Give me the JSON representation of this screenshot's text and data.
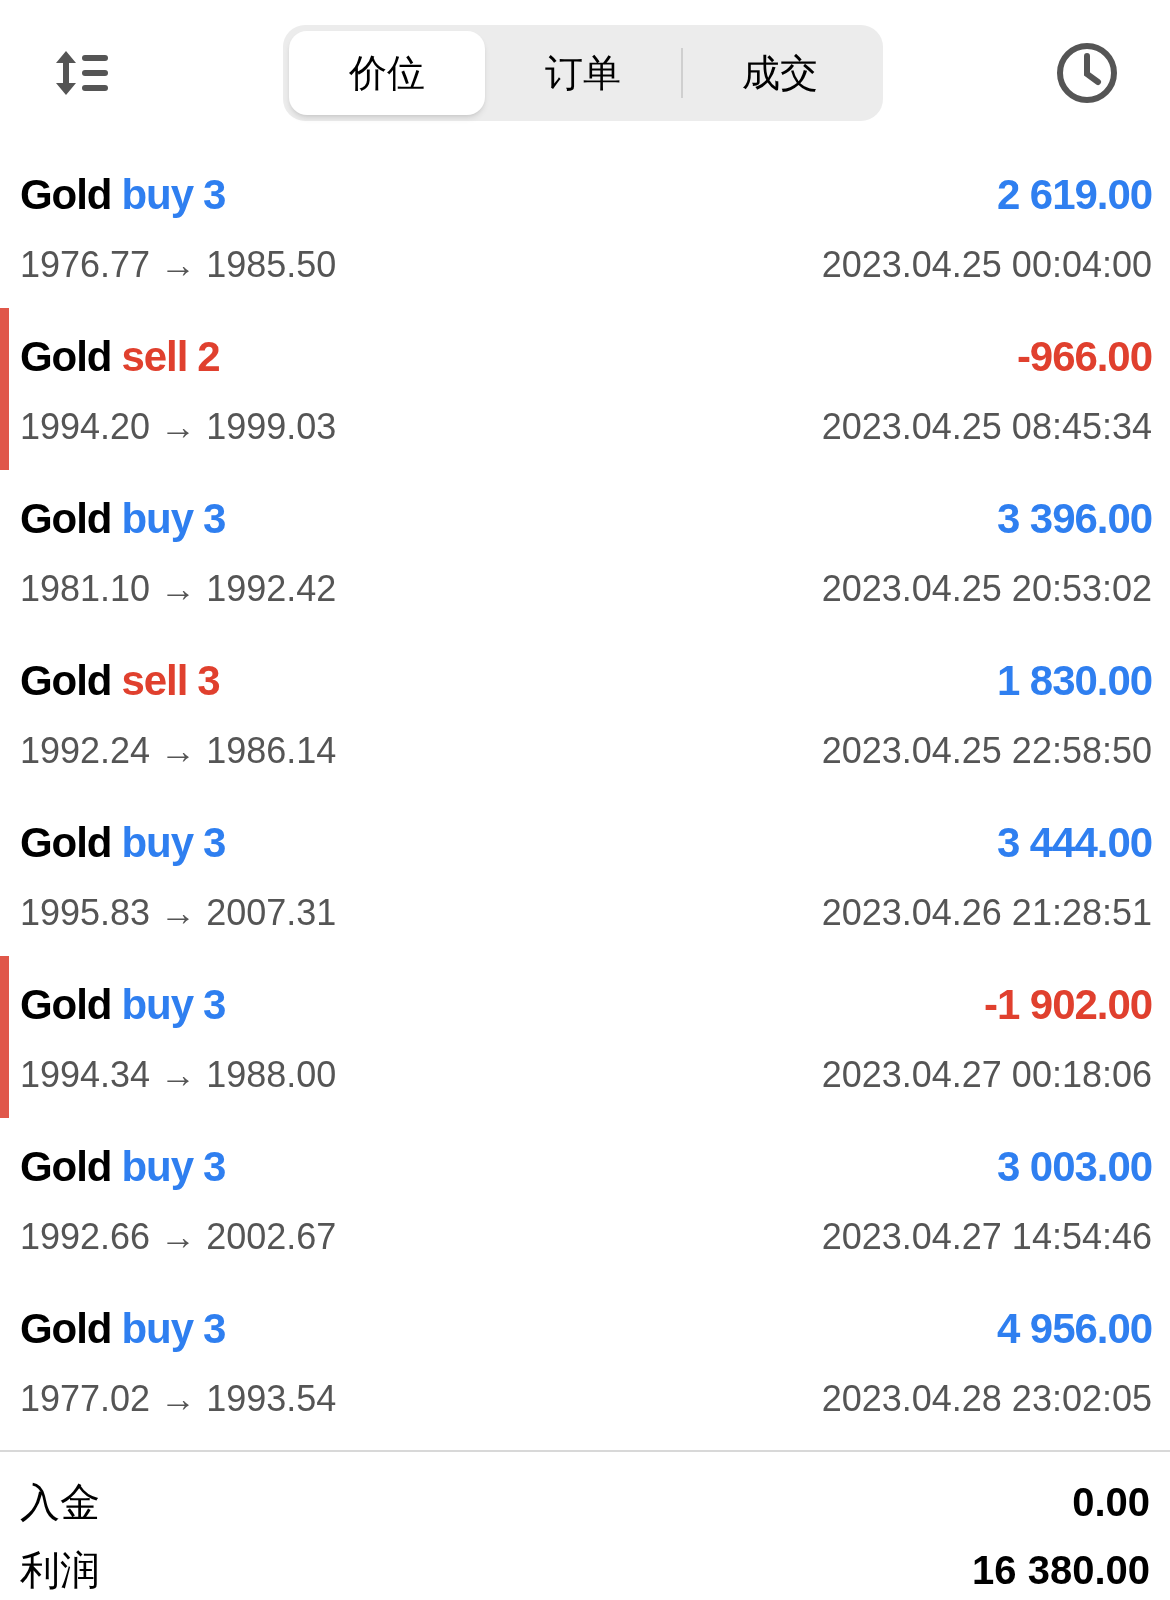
{
  "tabs": [
    {
      "label": "价位",
      "selected": true
    },
    {
      "label": "订单",
      "selected": false
    },
    {
      "label": "成交",
      "selected": false
    }
  ],
  "deals": [
    {
      "symbol": "Gold",
      "side": "buy",
      "volume": "3",
      "prices": "1976.77 → 1985.50",
      "profit": "2 619.00",
      "loss": false,
      "time": "2023.04.25 00:04:00"
    },
    {
      "symbol": "Gold",
      "side": "sell",
      "volume": "2",
      "prices": "1994.20 → 1999.03",
      "profit": "-966.00",
      "loss": true,
      "time": "2023.04.25 08:45:34"
    },
    {
      "symbol": "Gold",
      "side": "buy",
      "volume": "3",
      "prices": "1981.10 → 1992.42",
      "profit": "3 396.00",
      "loss": false,
      "time": "2023.04.25 20:53:02"
    },
    {
      "symbol": "Gold",
      "side": "sell",
      "volume": "3",
      "prices": "1992.24 → 1986.14",
      "profit": "1 830.00",
      "loss": false,
      "time": "2023.04.25 22:58:50"
    },
    {
      "symbol": "Gold",
      "side": "buy",
      "volume": "3",
      "prices": "1995.83 → 2007.31",
      "profit": "3 444.00",
      "loss": false,
      "time": "2023.04.26 21:28:51"
    },
    {
      "symbol": "Gold",
      "side": "buy",
      "volume": "3",
      "prices": "1994.34 → 1988.00",
      "profit": "-1 902.00",
      "loss": true,
      "time": "2023.04.27 00:18:06"
    },
    {
      "symbol": "Gold",
      "side": "buy",
      "volume": "3",
      "prices": "1992.66 → 2002.67",
      "profit": "3 003.00",
      "loss": false,
      "time": "2023.04.27 14:54:46"
    },
    {
      "symbol": "Gold",
      "side": "buy",
      "volume": "3",
      "prices": "1977.02 → 1993.54",
      "profit": "4 956.00",
      "loss": false,
      "time": "2023.04.28 23:02:05"
    }
  ],
  "summary": [
    {
      "label": "入金",
      "value": "0.00"
    },
    {
      "label": "利润",
      "value": "16 380.00"
    }
  ]
}
